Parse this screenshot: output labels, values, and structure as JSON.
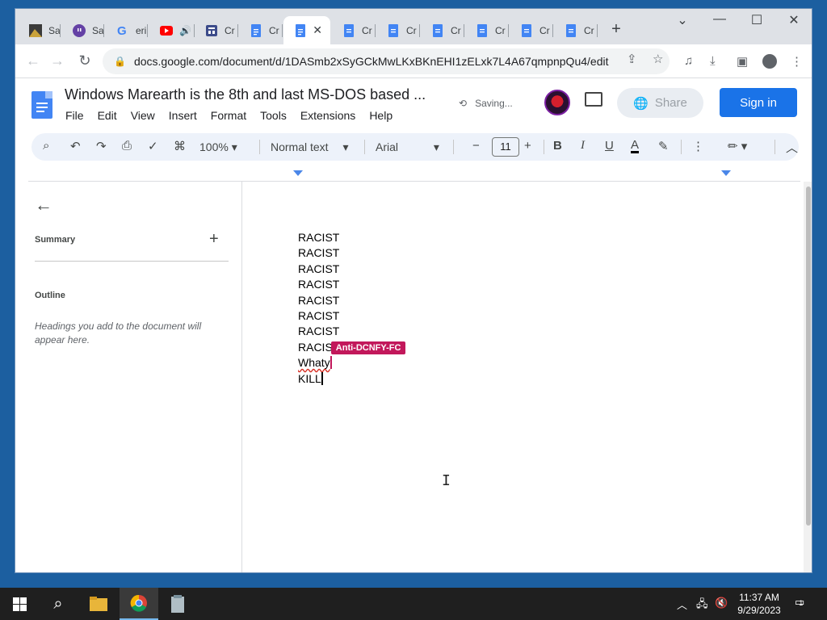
{
  "browser": {
    "tabs": [
      {
        "label": "Sa",
        "icon": "photo-favicon"
      },
      {
        "label": "Sa",
        "icon": "twitch-icon"
      },
      {
        "label": "eri",
        "icon": "google-icon"
      },
      {
        "label": "",
        "icon": "youtube-icon"
      },
      {
        "label": "Cr",
        "icon": "forms-icon"
      },
      {
        "label": "Cr",
        "icon": "docs-icon"
      },
      {
        "label": "",
        "icon": "docs-icon"
      },
      {
        "label": "Cr",
        "icon": "docs-icon"
      },
      {
        "label": "Cr",
        "icon": "docs-icon"
      },
      {
        "label": "Cr",
        "icon": "docs-icon"
      },
      {
        "label": "Cr",
        "icon": "docs-icon"
      },
      {
        "label": "Cr",
        "icon": "docs-icon"
      },
      {
        "label": "Cr",
        "icon": "docs-icon"
      }
    ],
    "url": "docs.google.com/document/d/1DASmb2xSyGCkMwLKxBKnEHI1zELxk7L4A67qmpnpQu4/edit"
  },
  "docs": {
    "title": "Windows Marearth is the 8th and last MS-DOS based ...",
    "saving": "Saving...",
    "menu": [
      "File",
      "Edit",
      "View",
      "Insert",
      "Format",
      "Tools",
      "Extensions",
      "Help"
    ],
    "share_label": "Share",
    "signin_label": "Sign in"
  },
  "toolbar": {
    "zoom": "100%",
    "style": "Normal text",
    "font": "Arial",
    "font_size": "11",
    "bold": "B",
    "italic": "I",
    "underline": "U",
    "text_color": "A"
  },
  "sidebar": {
    "summary_label": "Summary",
    "outline_label": "Outline",
    "outline_hint": "Headings you add to the document will appear here."
  },
  "document": {
    "lines": [
      "RACIST",
      "RACIST",
      "RACIST",
      "RACIST",
      "RACIST",
      "RACIST",
      "RACIST",
      "RACIS"
    ],
    "collaborator": "Anti-DCNFY-FC",
    "line_whaty": "Whaty",
    "line_kill": "KILL"
  },
  "taskbar": {
    "time": "11:37 AM",
    "date": "9/29/2023",
    "notifications": "1"
  }
}
